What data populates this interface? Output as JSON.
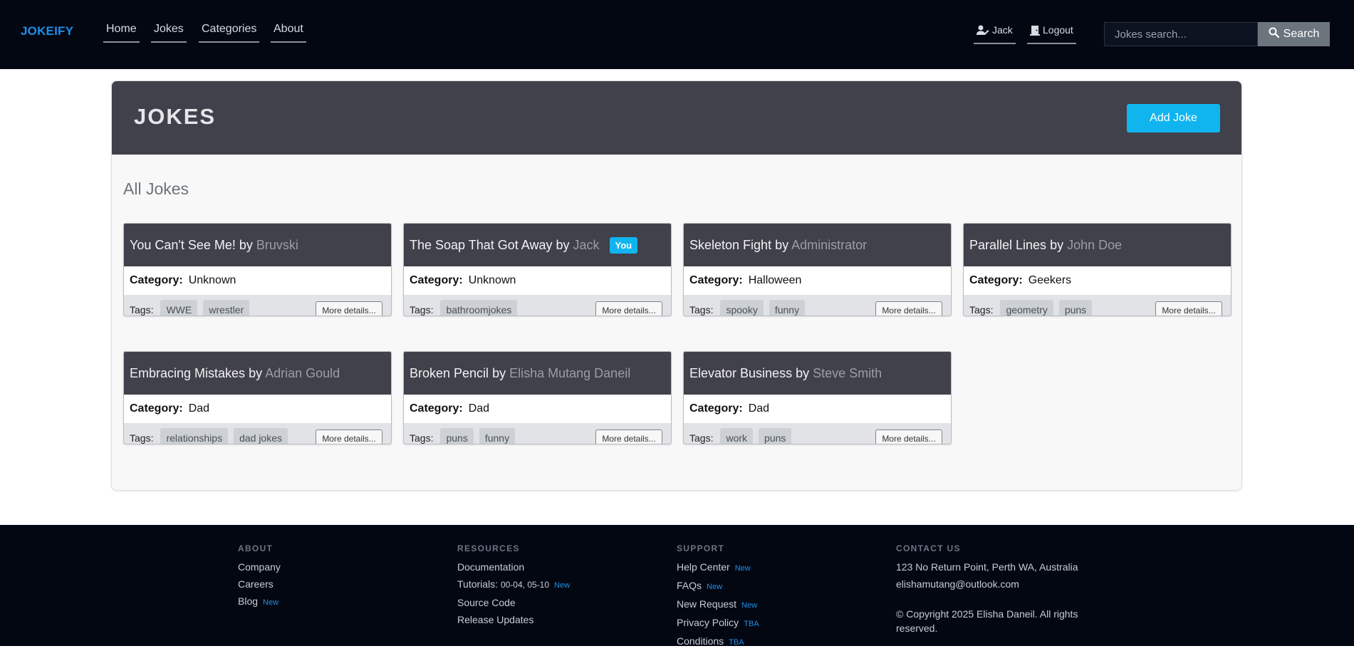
{
  "nav": {
    "brand": "JOKEIFY",
    "links": [
      "Home",
      "Jokes",
      "Categories",
      "About"
    ],
    "user": "Jack",
    "logout": "Logout",
    "search_placeholder": "Jokes search...",
    "search_label": "Search"
  },
  "page": {
    "title": "JOKES",
    "add_label": "Add Joke",
    "section_title": "All Jokes",
    "category_label": "Category:",
    "tags_label": "Tags:",
    "more_label": "More details...",
    "by_word": "by"
  },
  "jokes": [
    {
      "title": "You Can't See Me!",
      "author": "Bruvski",
      "category": "Unknown",
      "tags": [
        "WWE",
        "wrestler"
      ],
      "badge": ""
    },
    {
      "title": "The Soap That Got Away",
      "author": "Jack",
      "category": "Unknown",
      "tags": [
        "bathroomjokes"
      ],
      "badge": "You"
    },
    {
      "title": "Skeleton Fight",
      "author": "Administrator",
      "category": "Halloween",
      "tags": [
        "spooky",
        "funny"
      ],
      "badge": ""
    },
    {
      "title": "Parallel Lines",
      "author": "John Doe",
      "category": "Geekers",
      "tags": [
        "geometry",
        "puns"
      ],
      "badge": ""
    },
    {
      "title": "Embracing Mistakes",
      "author": "Adrian Gould",
      "category": "Dad",
      "tags": [
        "relationships",
        "dad jokes"
      ],
      "badge": ""
    },
    {
      "title": "Broken Pencil",
      "author": "Elisha Mutang Daneil",
      "category": "Dad",
      "tags": [
        "puns",
        "funny"
      ],
      "badge": ""
    },
    {
      "title": "Elevator Business",
      "author": "Steve Smith",
      "category": "Dad",
      "tags": [
        "work",
        "puns"
      ],
      "badge": ""
    }
  ],
  "footer": {
    "about": {
      "heading": "ABOUT",
      "items": [
        "Company",
        "Careers",
        "Blog"
      ],
      "blog_badge": "New"
    },
    "resources": {
      "heading": "RESOURCES",
      "documentation": "Documentation",
      "tutorials_label": "Tutorials:",
      "tutorials_dates": "00-04, 05-10",
      "tutorials_badge": "New",
      "source_code": "Source Code",
      "release_updates": "Release Updates"
    },
    "support": {
      "heading": "SUPPORT",
      "items": [
        {
          "label": "Help Center",
          "badge": "New"
        },
        {
          "label": "FAQs",
          "badge": "New"
        },
        {
          "label": "New Request",
          "badge": "New"
        },
        {
          "label": "Privacy Policy",
          "badge": "TBA"
        },
        {
          "label": "Conditions",
          "badge": "TBA"
        }
      ]
    },
    "contact": {
      "heading": "CONTACT US",
      "address": "123 No Return Point, Perth WA, Australia",
      "email": "elishamutang@outlook.com",
      "copyright": "© Copyright 2025 Elisha Daneil. All rights reserved."
    }
  },
  "colors": {
    "accent": "#10b5f0",
    "brand": "#1e90e8",
    "nav_bg": "#030712",
    "card_header": "#40414a"
  }
}
